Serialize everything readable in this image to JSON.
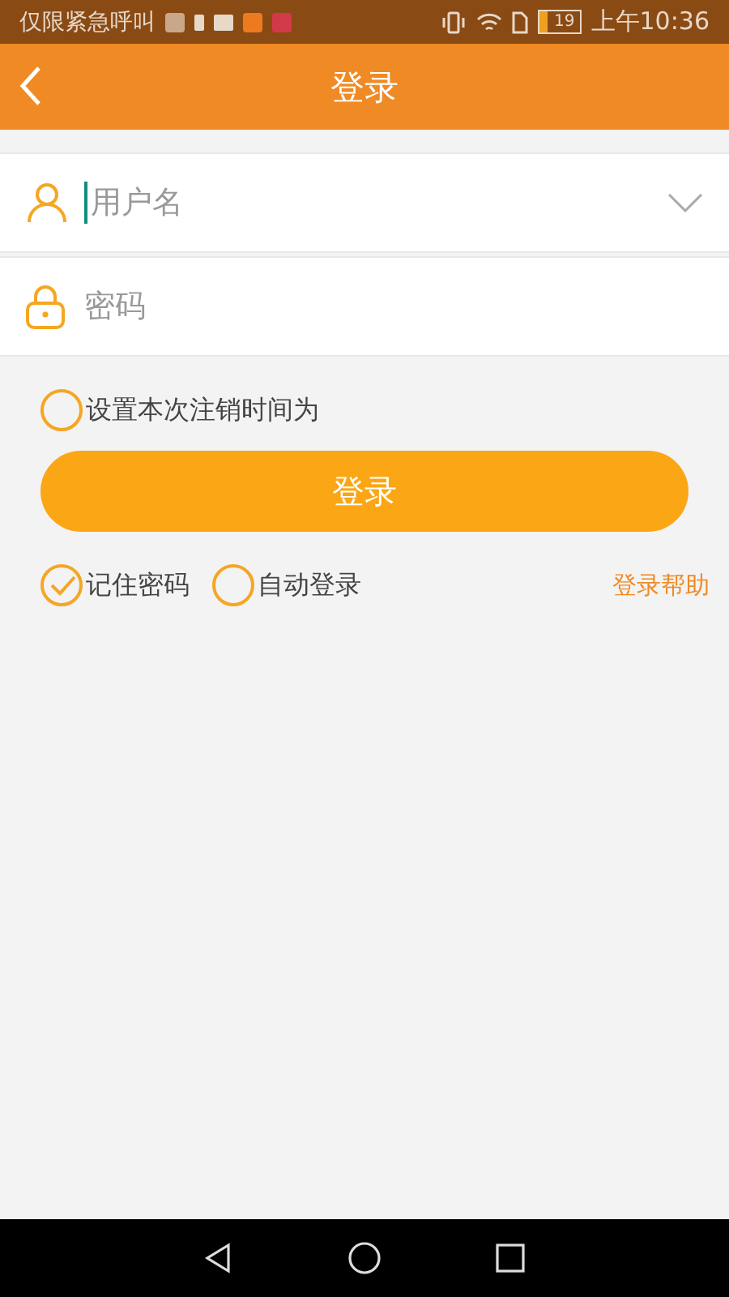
{
  "status_bar": {
    "carrier": "仅限紧急呼叫",
    "battery": "19",
    "time": "上午10:36"
  },
  "header": {
    "title": "登录"
  },
  "username": {
    "placeholder": "用户名"
  },
  "password": {
    "placeholder": "密码"
  },
  "logout_option": {
    "label": "设置本次注销时间为",
    "checked": false
  },
  "login_button": {
    "label": "登录"
  },
  "options": [
    {
      "label": "记住密码",
      "checked": true
    },
    {
      "label": "自动登录",
      "checked": false
    }
  ],
  "help_link": "登录帮助"
}
